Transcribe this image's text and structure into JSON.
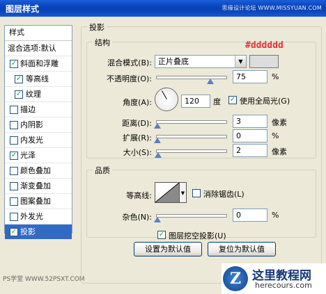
{
  "window": {
    "title": "图层样式",
    "watermark": "思缘设计论坛 WWW.MISSYUAN.COM"
  },
  "stylelist": {
    "header": "样式",
    "items": [
      {
        "label": "混合选项:默认",
        "checkbox": false
      },
      {
        "label": "斜面和浮雕",
        "checkbox": true,
        "checked": true
      },
      {
        "label": "等高线",
        "checkbox": true,
        "checked": true,
        "sub": true
      },
      {
        "label": "纹理",
        "checkbox": true,
        "checked": true,
        "sub": true
      },
      {
        "label": "描边",
        "checkbox": true,
        "checked": false
      },
      {
        "label": "内阴影",
        "checkbox": true,
        "checked": false
      },
      {
        "label": "内发光",
        "checkbox": true,
        "checked": false
      },
      {
        "label": "光泽",
        "checkbox": true,
        "checked": true
      },
      {
        "label": "颜色叠加",
        "checkbox": true,
        "checked": false
      },
      {
        "label": "渐变叠加",
        "checkbox": true,
        "checked": false
      },
      {
        "label": "图案叠加",
        "checkbox": true,
        "checked": false
      },
      {
        "label": "外发光",
        "checkbox": true,
        "checked": false
      },
      {
        "label": "投影",
        "checkbox": true,
        "checked": true,
        "selected": true
      }
    ]
  },
  "dropshadow": {
    "title": "投影",
    "structure": {
      "title": "结构",
      "blend_mode_label": "混合模式(B):",
      "blend_mode_value": "正片叠底",
      "color_hex": "#dddddd",
      "opacity_label": "不透明度(O):",
      "opacity_value": "75",
      "opacity_unit": "%",
      "opacity_fraction": 0.75,
      "angle_label": "角度(A):",
      "angle_value": "120",
      "angle_unit": "度",
      "global_light_label": "使用全局光(G)",
      "global_light_checked": true,
      "distance_label": "距离(D):",
      "distance_value": "3",
      "distance_unit": "像素",
      "spread_label": "扩展(R):",
      "spread_value": "0",
      "spread_unit": "%",
      "size_label": "大小(S):",
      "size_value": "2",
      "size_unit": "像素"
    },
    "quality": {
      "title": "品质",
      "contour_label": "等高线:",
      "antialias_label": "消除锯齿(L)",
      "antialias_checked": false,
      "noise_label": "杂色(N):",
      "noise_value": "0",
      "noise_unit": "%"
    },
    "knockout_label": "图层挖空投影(U)",
    "knockout_checked": true,
    "make_default_label": "设置为默认值",
    "reset_default_label": "复位为默认值"
  },
  "footer": {
    "ps_logo": "PS学堂 WWW.52PSXT.COM",
    "brand_logo": "Z",
    "brand_name": "这里教程网",
    "brand_url": "herecours.com"
  },
  "check_glyph": "✓"
}
